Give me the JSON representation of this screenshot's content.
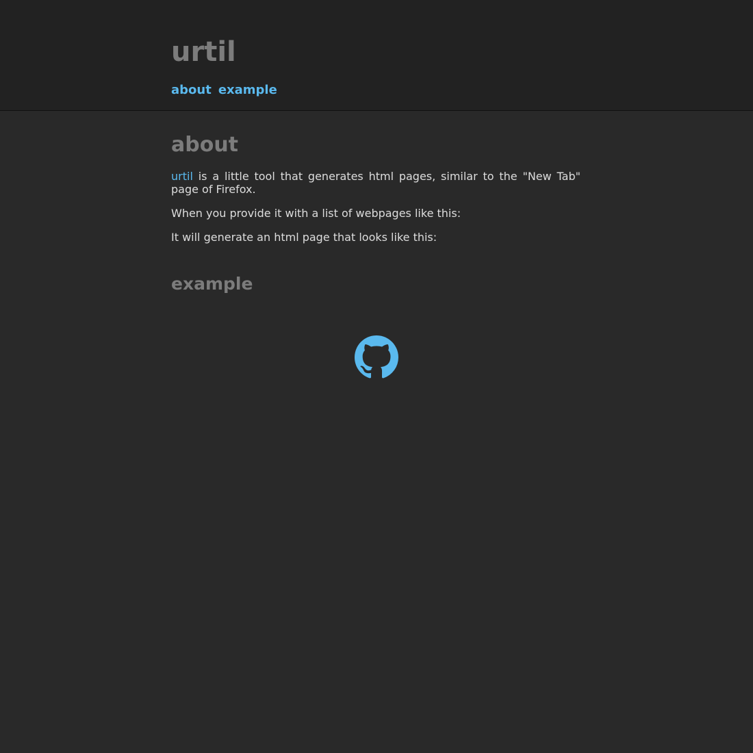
{
  "header": {
    "title": "urtil",
    "nav": [
      {
        "label": "about"
      },
      {
        "label": "example"
      }
    ]
  },
  "about": {
    "title": "about",
    "intro_link": "urtil",
    "intro_rest": " is a little tool that generates html pages, similar to the \"New Tab\" page of Firefox.",
    "para2": "When you provide it with a list of webpages like this:",
    "para3": "It will generate an html page that looks like this:"
  },
  "example": {
    "title": "example"
  },
  "footer": {
    "icon": "github-icon"
  },
  "colors": {
    "accent": "#5ab9ee",
    "background": "#292929",
    "header_background": "#222222",
    "heading": "#7c7c7c",
    "text": "#dddddd"
  }
}
